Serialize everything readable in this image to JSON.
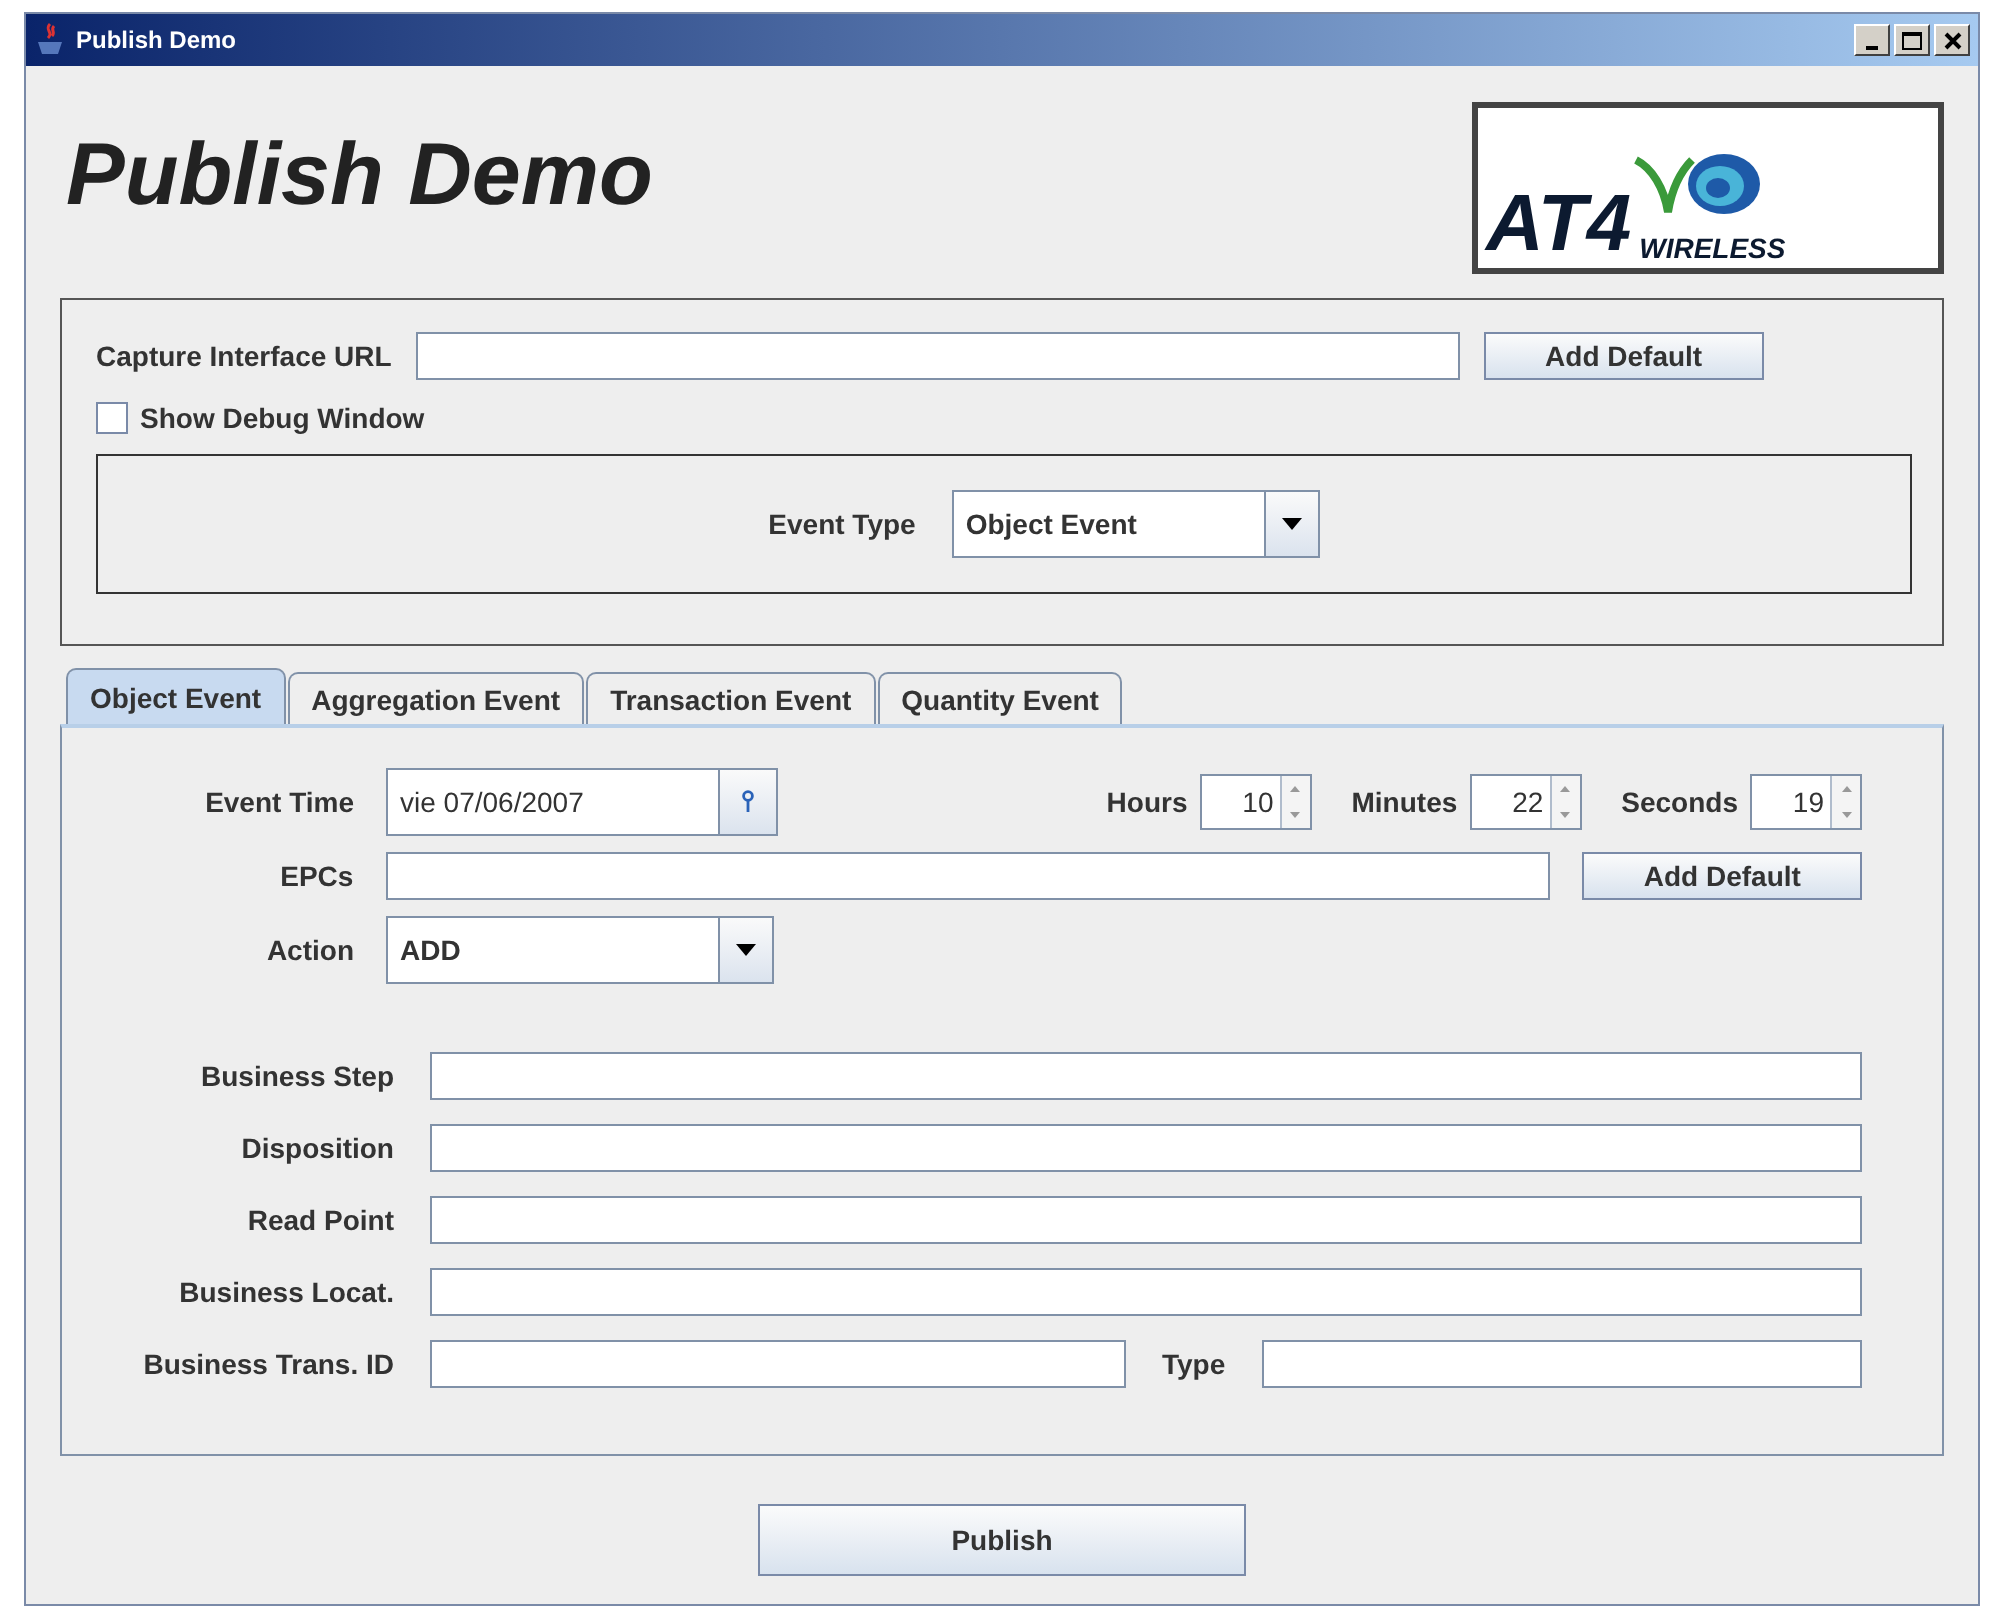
{
  "window": {
    "title": "Publish Demo"
  },
  "header": {
    "title": "Publish Demo",
    "logo": {
      "brand": "AT4",
      "tagline": "WIRELESS"
    }
  },
  "capture": {
    "label": "Capture Interface URL",
    "button": "Add Default"
  },
  "debug": {
    "label": "Show Debug Window",
    "checked": false
  },
  "event_type": {
    "label": "Event Type",
    "value": "Object Event"
  },
  "tabs": [
    {
      "label": "Object Event",
      "selected": true
    },
    {
      "label": "Aggregation Event",
      "selected": false
    },
    {
      "label": "Transaction Event",
      "selected": false
    },
    {
      "label": "Quantity Event",
      "selected": false
    }
  ],
  "event_time": {
    "label": "Event Time",
    "value": "vie 07/06/2007"
  },
  "time": [
    {
      "label": "Hours",
      "value": "10"
    },
    {
      "label": "Minutes",
      "value": "22"
    },
    {
      "label": "Seconds",
      "value": "19"
    }
  ],
  "epcs": {
    "label": "EPCs",
    "button": "Add Default"
  },
  "action": {
    "label": "Action",
    "value": "ADD"
  },
  "fields": [
    {
      "label": "Business Step"
    },
    {
      "label": "Disposition"
    },
    {
      "label": "Read Point"
    },
    {
      "label": "Business Locat."
    }
  ],
  "trans": {
    "label": "Business Trans. ID",
    "type_label": "Type"
  },
  "publish_button": "Publish"
}
